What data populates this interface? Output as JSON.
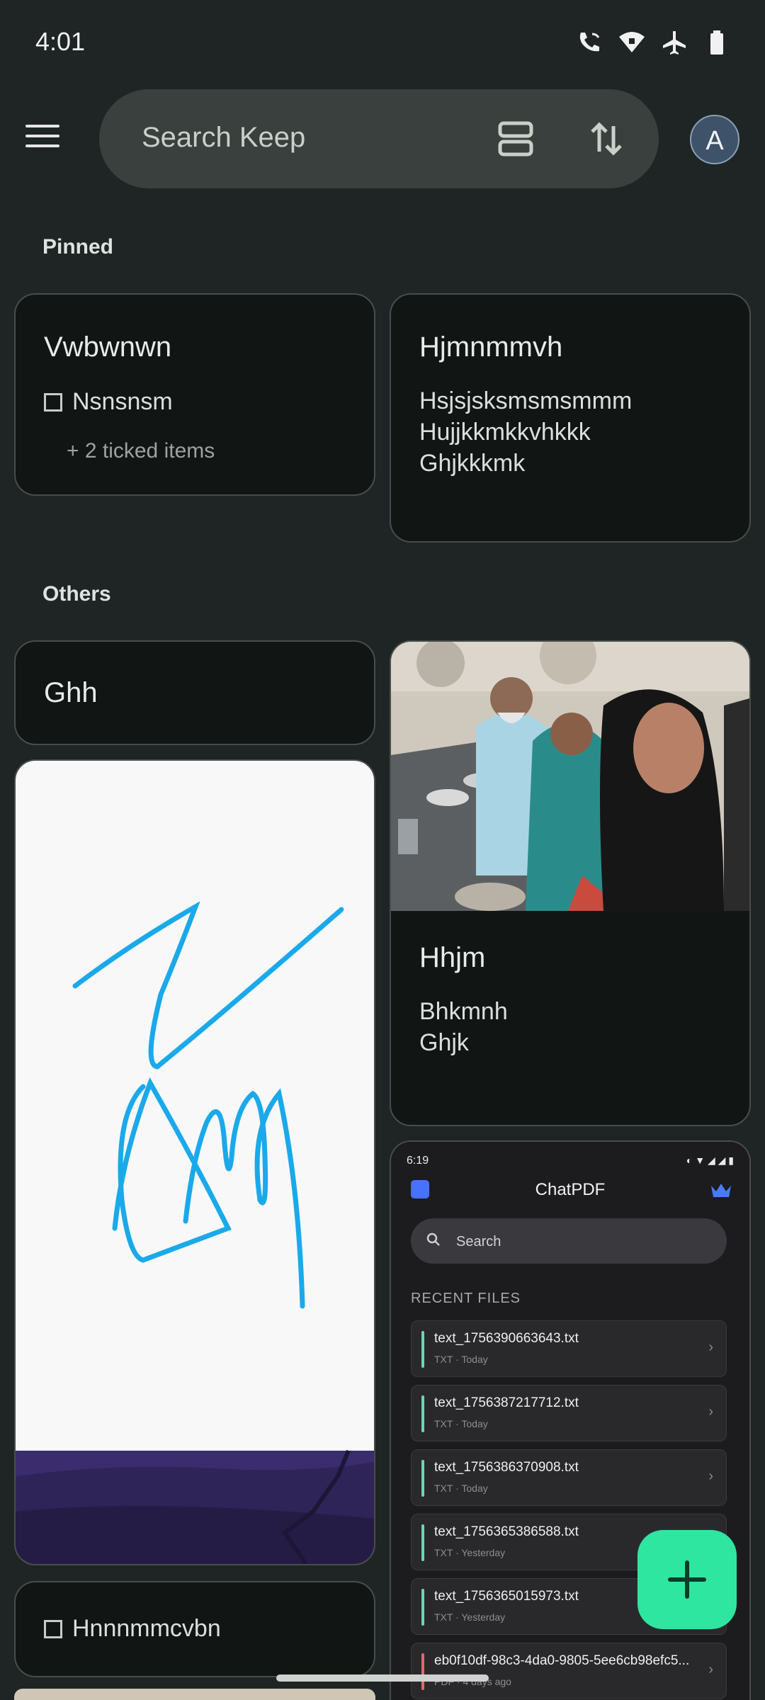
{
  "status_bar": {
    "time": "4:01"
  },
  "topbar": {
    "search_placeholder": "Search Keep",
    "avatar_letter": "A"
  },
  "sections": {
    "pinned": "Pinned",
    "others": "Others"
  },
  "notes": {
    "pinned_1": {
      "title": "Vwbwnwn",
      "checkbox_item": "Nsnsnsm",
      "ticked": "+ 2 ticked items"
    },
    "pinned_2": {
      "title": "Hjmnmmvh",
      "lines": [
        "Hsjsjsksmsmsmmm",
        "Hujjkkmkkvhkkk",
        "Ghjkkkmk"
      ]
    },
    "other_1": {
      "title": "Ghh"
    },
    "photo_note": {
      "title": "Hhjm",
      "lines": [
        "Bhkmnh",
        "Ghjk"
      ]
    },
    "checklist_note": {
      "checkbox_item": "Hnnnmmcvbn"
    }
  },
  "chatpdf_screenshot": {
    "time": "6:19",
    "app_title": "ChatPDF",
    "search_placeholder": "Search",
    "recent_label": "RECENT FILES",
    "files": [
      {
        "name": "text_1756390663643.txt",
        "meta": "TXT · Today"
      },
      {
        "name": "text_1756387217712.txt",
        "meta": "TXT · Today"
      },
      {
        "name": "text_1756386370908.txt",
        "meta": "TXT · Today"
      },
      {
        "name": "text_1756365386588.txt",
        "meta": "TXT · Yesterday"
      },
      {
        "name": "text_1756365015973.txt",
        "meta": "TXT · Yesterday"
      },
      {
        "name": "eb0f10df-98c3-4da0-9805-5ee6cb98efc5...",
        "meta": "PDF · 4 days ago"
      }
    ]
  },
  "colors": {
    "fab": "#2ee6a0",
    "accent_sketch": "#1aa9ea"
  }
}
